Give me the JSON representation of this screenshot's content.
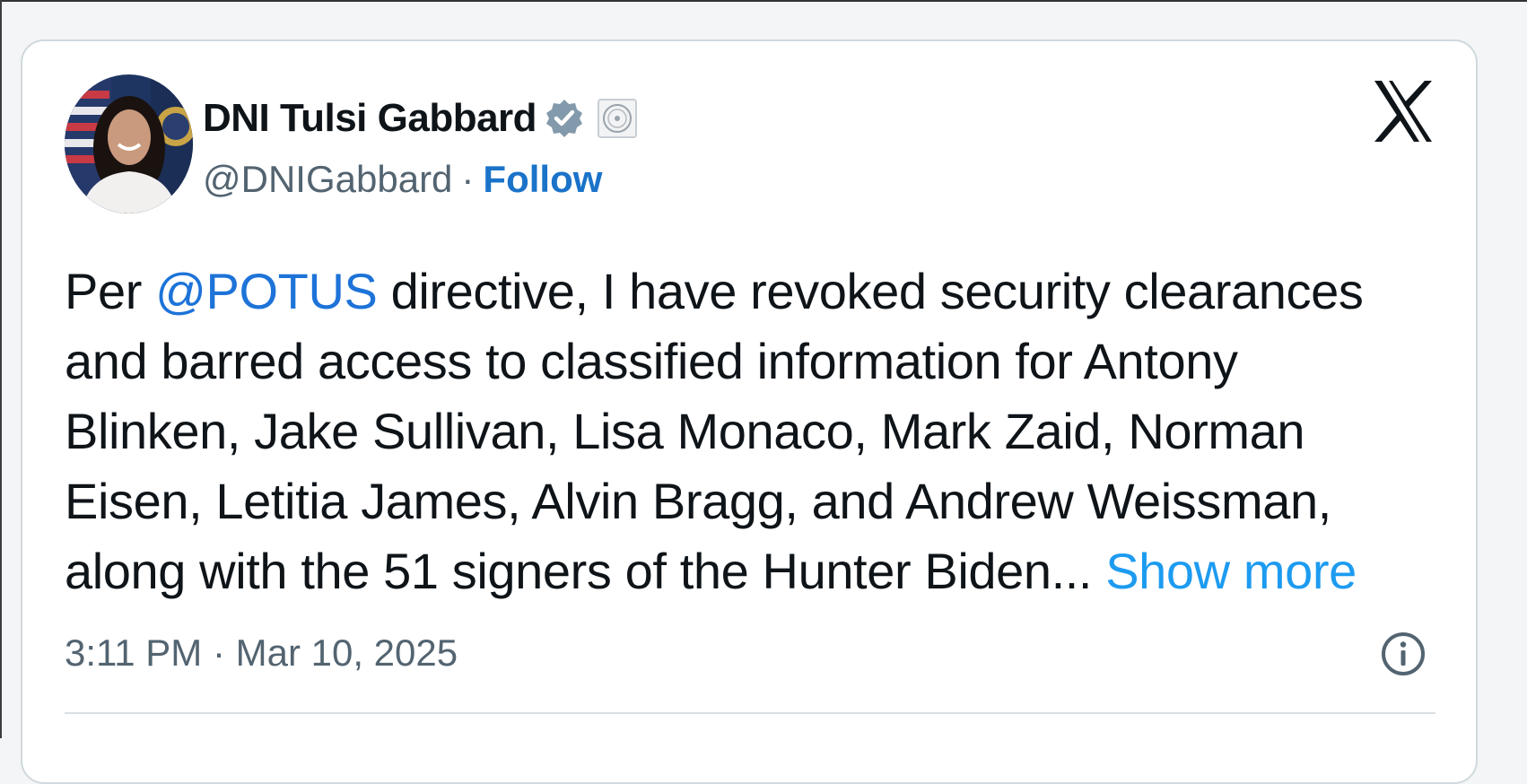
{
  "post": {
    "author": {
      "display_name": "DNI Tulsi Gabbard",
      "handle": "@DNIGabbard",
      "separator": "·",
      "follow_label": "Follow",
      "verified": true,
      "verified_badge_color": "#829aab",
      "affiliation_icon": "government-seal-icon"
    },
    "platform_icon": "x-logo-icon",
    "text": {
      "line1_prefix": "Per ",
      "mention": "@POTUS",
      "line1_suffix": " directive, I have revoked security clearances",
      "line2": "and barred access to classified information for Antony",
      "line3": "Blinken, Jake Sullivan, Lisa Monaco, Mark Zaid, Norman",
      "line4": "Eisen, Letitia James, Alvin Bragg, and Andrew Weissman,",
      "line5": "along with the 51 signers of the Hunter Biden... ",
      "show_more": "Show more"
    },
    "timestamp": "3:11 PM · Mar 10, 2025",
    "info_icon": "info-icon"
  },
  "colors": {
    "text_primary": "#0f1419",
    "text_secondary": "#536471",
    "link": "#1d9bf0",
    "card_border": "#cfd9de"
  }
}
